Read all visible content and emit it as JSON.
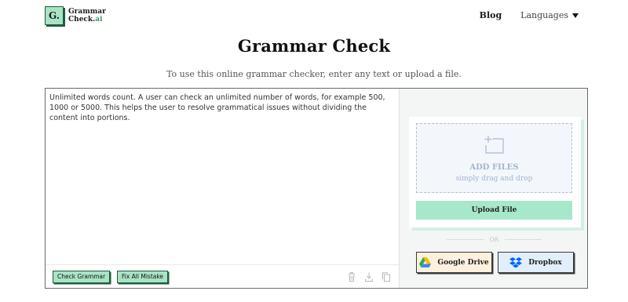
{
  "header": {
    "logo_mark": "G.",
    "logo_line1": "Grammar",
    "logo_line2_prefix": "Check.",
    "logo_line2_suffix": "ai",
    "nav_blog": "Blog",
    "nav_languages": "Languages"
  },
  "hero": {
    "title": "Grammar Check",
    "subtitle": "To use this online grammar checker, enter any text or upload a file."
  },
  "editor": {
    "text": "Unlimited words count. A user can check an unlimited number of words, for example 500, 1000 or 5000. This helps the user to resolve grammatical issues without dividing the content into portions.",
    "check_button": "Check Grammar",
    "fix_button": "Fix All Mistake"
  },
  "upload": {
    "add_files": "ADD FILES",
    "drag_hint": "simply drag and drop",
    "upload_button": "Upload File",
    "or_label": "OR",
    "google_drive": "Google Drive",
    "dropbox": "Dropbox"
  },
  "colors": {
    "accent_green": "#a9e3c6",
    "dark_green": "#1f5c3a",
    "drop_text": "#a4b4cf"
  }
}
